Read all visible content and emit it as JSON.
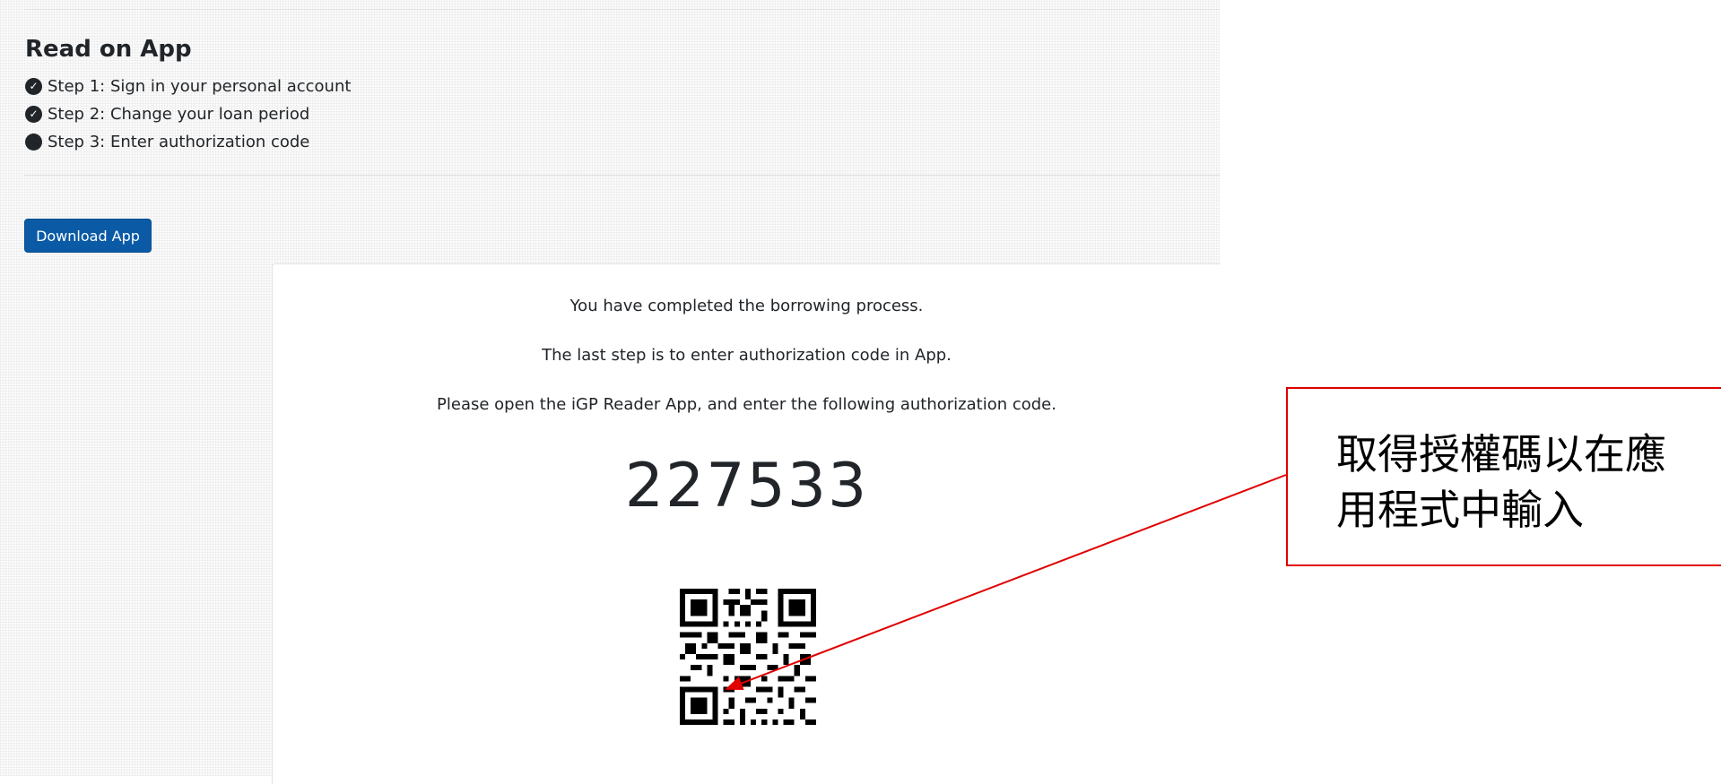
{
  "section": {
    "title": "Read on App",
    "steps": [
      {
        "label": "Step 1: Sign in your personal account",
        "icon": "check-circle-icon"
      },
      {
        "label": "Step 2: Change your loan period",
        "icon": "check-circle-icon"
      },
      {
        "label": "Step 3: Enter authorization code",
        "icon": "filled-circle-icon"
      }
    ]
  },
  "download_button": {
    "label": "Download App"
  },
  "panel": {
    "message_1": "You have completed the borrowing process.",
    "message_2": "The last step is to enter authorization code in App.",
    "message_3": "Please open the iGP Reader App, and enter the following authorization code.",
    "authorization_code": "227533",
    "qr_icon": "qr-code-icon"
  },
  "annotation": {
    "text": "取得授權碼以在應用程式中輸入",
    "color": "#e00000"
  },
  "colors": {
    "button": "#0b5aa6",
    "text": "#212529",
    "annotation": "#e00000"
  }
}
